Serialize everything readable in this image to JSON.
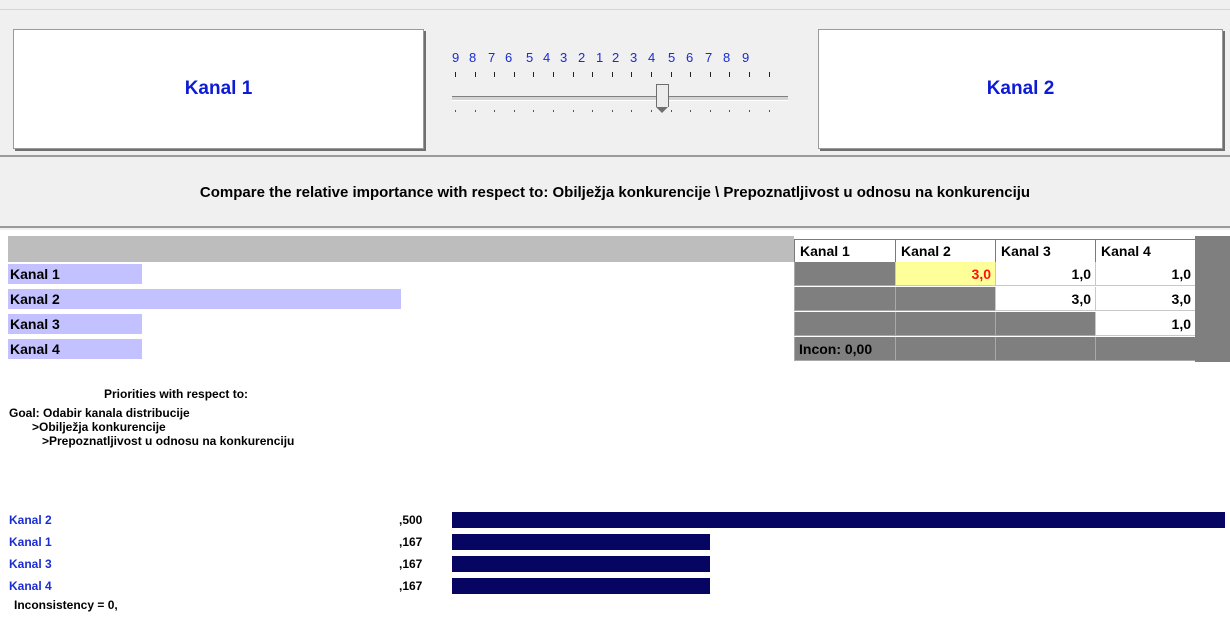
{
  "comparison": {
    "left_item": "Kanal 1",
    "right_item": "Kanal 2",
    "scale_labels": [
      "9",
      "8",
      "7",
      "6",
      "5",
      "4",
      "3",
      "2",
      "1",
      "2",
      "3",
      "4",
      "5",
      "6",
      "7",
      "8",
      "9"
    ],
    "slider_value_fraction": 0.625
  },
  "prompt": "Compare the relative importance with respect to: Obilježja konkurencije  \\ Prepoznatljivost u odnosu na konkurenciju",
  "matrix": {
    "columns": [
      "Kanal 1",
      "Kanal 2",
      "Kanal 3",
      "Kanal 4"
    ],
    "rows": [
      {
        "label": "Kanal 1",
        "bar_fraction": 0.17,
        "cells": [
          "",
          "3,0",
          "1,0",
          "1,0"
        ]
      },
      {
        "label": "Kanal 2",
        "bar_fraction": 0.5,
        "cells": [
          "",
          "",
          "3,0",
          "3,0"
        ]
      },
      {
        "label": "Kanal 3",
        "bar_fraction": 0.17,
        "cells": [
          "",
          "",
          "",
          "1,0"
        ]
      },
      {
        "label": "Kanal 4",
        "bar_fraction": 0.17,
        "cells": [
          "Incon: 0,00",
          "",
          "",
          ""
        ]
      }
    ]
  },
  "priorities": {
    "title": "Priorities with respect to:",
    "goal_lines": [
      "Goal: Odabir kanala distribucije",
      ">Obilježja konkurencije",
      ">Prepoznatljivost u odnosu na konkurenciju"
    ],
    "results": [
      {
        "name": "Kanal 2",
        "value_text": ",500",
        "value": 0.5
      },
      {
        "name": "Kanal 1",
        "value_text": ",167",
        "value": 0.167
      },
      {
        "name": "Kanal 3",
        "value_text": ",167",
        "value": 0.167
      },
      {
        "name": "Kanal 4",
        "value_text": ",167",
        "value": 0.167
      }
    ],
    "inconsistency": "Inconsistency = 0,"
  },
  "colors": {
    "accent_text": "#0d1bd6",
    "bar": "#060662",
    "row_bar": "#c3c1ff",
    "highlight_cell": "#ffff99",
    "highlight_text": "#ff1010"
  }
}
